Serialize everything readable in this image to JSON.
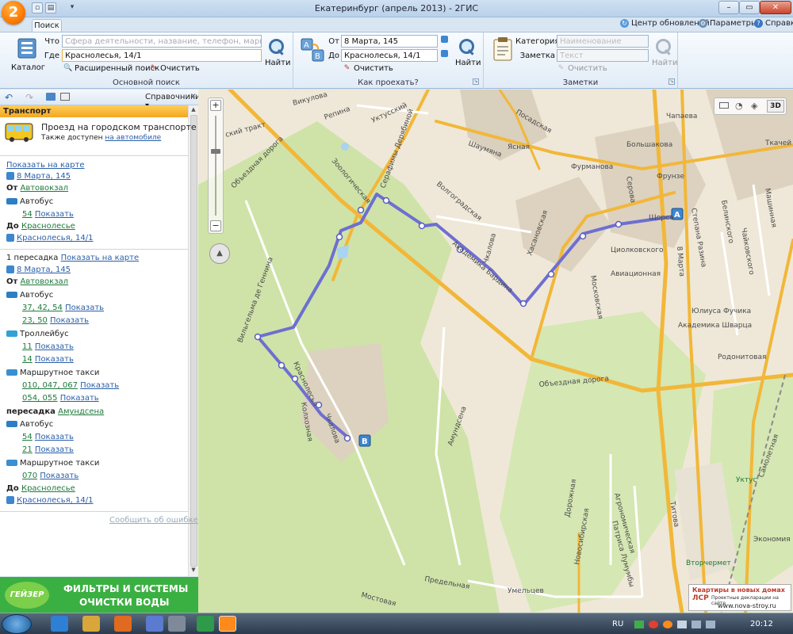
{
  "window": {
    "title": "Екатеринбург (апрель 2013) - 2ГИС",
    "logo_text": "2",
    "tab": "Поиск",
    "update_center": "Центр обновлений",
    "settings": "Параметры",
    "help": "Справка"
  },
  "ribbon": {
    "catalog_label": "Каталог",
    "what_label": "Что",
    "what_placeholder": "Сфера деятельности, название, телефон, маршрут",
    "where_label": "Где",
    "where_value": "Краснолесья, 14/1",
    "find_label": "Найти",
    "advanced_search": "Расширенный поиск",
    "clear": "Очистить",
    "group_main": "Основной поиск",
    "from_label": "От",
    "from_value": "8 Марта, 145",
    "to_label": "До",
    "to_value": "Краснолесья, 14/1",
    "route_find": "Найти",
    "route_clear": "Очистить",
    "group_route": "Как проехать?",
    "category_label": "Категория",
    "category_placeholder": "Наименование",
    "note_label": "Заметка",
    "note_placeholder": "Текст",
    "notes_find": "Найти",
    "notes_clear": "Очистить",
    "group_notes": "Заметки"
  },
  "panel": {
    "directories": "Справочники",
    "section": "Транспорт",
    "header_title": "Проезд на городском транспорте",
    "header_sub": "Также доступен",
    "header_link": "на автомобиле",
    "route1": {
      "show_on_map": "Показать на карте",
      "start": "8 Марта, 145",
      "from_label": "От",
      "from_stop": "Автовокзал",
      "bus_label": "Автобус",
      "bus_num": "54",
      "show": "Показать",
      "to_label": "До",
      "to_stop": "Красноле­сье",
      "end": "Краснолесья, 14/1"
    },
    "route2": {
      "transfers": "1 пересадка",
      "show_on_map": "Показать на карте",
      "start": "8 Марта, 145",
      "from_label": "От",
      "from_stop": "Автовокзал",
      "bus_label": "Автобус",
      "bus_nums_1": "37, 42, 54",
      "bus_nums_2": "23, 50",
      "trolley_label": "Троллейбус",
      "trolley_1": "11",
      "trolley_2": "14",
      "taxi_label": "Маршрутное такси",
      "taxi_1": "010, 047, 067",
      "taxi_2": "054, 055",
      "transfer_label": "пересадка",
      "transfer_stop": "Амундсена",
      "bus2_label": "Автобус",
      "bus2_1": "54",
      "bus2_2": "21",
      "taxi2_label": "Маршрутное такси",
      "taxi2_1": "070",
      "to_label": "До",
      "to_stop": "Краснолесье",
      "end": "Краснолесья, 14/1",
      "show": "Показать"
    },
    "report_error": "Сообщить об ошибке"
  },
  "ad_left": {
    "brand": "ГЕЙЗЕР",
    "line1": "ФИЛЬТРЫ И СИСТЕМЫ",
    "line2": "ОЧИСТКИ ВОДЫ"
  },
  "ad_map": {
    "line1": "Квартиры в новых домах",
    "brand": "ЛСР",
    "sub": "Проектные декларации на сайте",
    "url": "www.nova-stroy.ru"
  },
  "map": {
    "view3d": "3D",
    "marker_a": "A",
    "marker_b": "B",
    "streets": {
      "vikulova": "Викулова",
      "repina": "Репина",
      "uktusskaya": "Уктусский",
      "trakt": "ский тракт",
      "posadskaya": "Посадская",
      "shaumyana": "Шаумяна",
      "yasnaya": "Ясная",
      "furmanova": "Фурманова",
      "bolshakova": "Большакова",
      "chapaeva": "Чапаева",
      "tkachey": "Ткачей",
      "serafimy": "Серафимы Дерябиной",
      "zoo": "Зоологическая",
      "volgogradskaya": "Волгоградская",
      "obezdnaya": "Объездная дорога",
      "obezdnaya2": "Объездная дорога",
      "khasanovskaya": "Хасановская",
      "chkalova": "Чкалова",
      "baronа": "Академика Бардина",
      "moskovskaya": "Московская",
      "serova": "Серова",
      "frunze": "Фрунзе",
      "shorsa": "Щорса",
      "stepana": "Степана Разина",
      "vosmogo": "8 Марта",
      "belinskogo": "Белинского",
      "chaykovskogo": "Чайковского",
      "tsiolkovskogo": "Циолковского",
      "aviatsionnaya": "Авиационная",
      "fuchika": "Юлиуса Фучика",
      "shvartsa": "Академика Шварца",
      "rodonitovaya": "Родонитовая",
      "mashinnaya": "Машинная",
      "gennina": "Вильгельма де Геннина",
      "krasnolesya": "Краснолесья",
      "kolkhoznaya": "Колхозная",
      "chkalova2": "Чкалова",
      "amundsena": "Амундсена",
      "titova": "Титова",
      "agronomicheskaya": "Агрономическая",
      "samoletnaya": "Самолетная",
      "dorozhnaya": "Дорожная",
      "lumumby": "Патриса Лумумбы",
      "novosibirskaya": "Новосибирская",
      "predelnaya": "Предельная",
      "umeltsev": "Умельцев",
      "mostovaya": "Мостовая",
      "uktus": "Уктус",
      "vtorchermet": "Вторчермет",
      "ekonomiya": "Экономия"
    }
  },
  "taskbar": {
    "lang": "RU",
    "time": "20:12"
  }
}
